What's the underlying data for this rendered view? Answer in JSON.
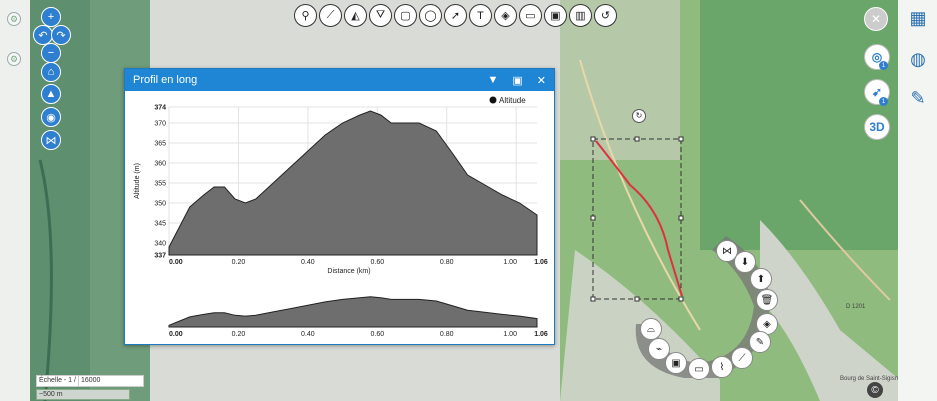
{
  "map": {
    "scale_label": "Échelle - 1 /",
    "scale_value": "16000",
    "scale_bar_label": "~500 m",
    "road_label_1": "D 1201",
    "road_label_2": "Bourg de Saint-Sigismond"
  },
  "toolbar": {
    "tools": [
      {
        "name": "marker-tool",
        "glyph": "⚲"
      },
      {
        "name": "line-tool",
        "glyph": "⟋"
      },
      {
        "name": "polyline-tool",
        "glyph": "◭"
      },
      {
        "name": "polygon-tool",
        "glyph": "⛛"
      },
      {
        "name": "rectangle-tool",
        "glyph": "▢"
      },
      {
        "name": "circle-tool",
        "glyph": "◯"
      },
      {
        "name": "arrow-tool",
        "glyph": "➚"
      },
      {
        "name": "text-tool",
        "glyph": "T"
      },
      {
        "name": "fill-tool",
        "glyph": "◈"
      },
      {
        "name": "measure-tool",
        "glyph": "▭"
      },
      {
        "name": "measure-area-tool",
        "glyph": "▣"
      },
      {
        "name": "altitude-tool",
        "glyph": "▥"
      },
      {
        "name": "undo-tool",
        "glyph": "↺"
      }
    ]
  },
  "panel": {
    "title": "Profil en long",
    "legend": "Altitude",
    "ylabel": "Altitude (m)",
    "xlabel": "Distance (km)",
    "yticks": [
      "374",
      "370",
      "365",
      "360",
      "355",
      "350",
      "345",
      "340",
      "337"
    ],
    "xticks": [
      "0.00",
      "0.20",
      "0.40",
      "0.60",
      "0.80",
      "1.00",
      "1.06"
    ],
    "xticks_mini": [
      "0.00",
      "0.20",
      "0.40",
      "0.60",
      "0.80",
      "1.00",
      "1.06"
    ]
  },
  "right_panel": {
    "threed_label": "3D",
    "badge_one": "1",
    "badge_two": "1"
  },
  "copyright_glyph": "©",
  "chart_data": {
    "type": "area",
    "title": "",
    "xlabel": "Distance (km)",
    "ylabel": "Altitude (m)",
    "xlim": [
      0,
      1.06
    ],
    "ylim": [
      337,
      374
    ],
    "legend": "top-right",
    "series": [
      {
        "name": "Altitude",
        "x": [
          0.0,
          0.03,
          0.06,
          0.1,
          0.13,
          0.16,
          0.19,
          0.22,
          0.25,
          0.3,
          0.35,
          0.4,
          0.45,
          0.5,
          0.55,
          0.58,
          0.61,
          0.64,
          0.67,
          0.72,
          0.77,
          0.82,
          0.86,
          0.9,
          0.96,
          1.01,
          1.06
        ],
        "values": [
          339,
          344,
          349,
          352,
          354,
          354,
          351,
          350,
          351,
          355,
          359,
          363,
          367,
          370,
          372,
          373,
          372,
          370,
          370,
          370,
          368,
          362,
          357,
          355,
          352,
          350,
          347
        ]
      }
    ]
  }
}
